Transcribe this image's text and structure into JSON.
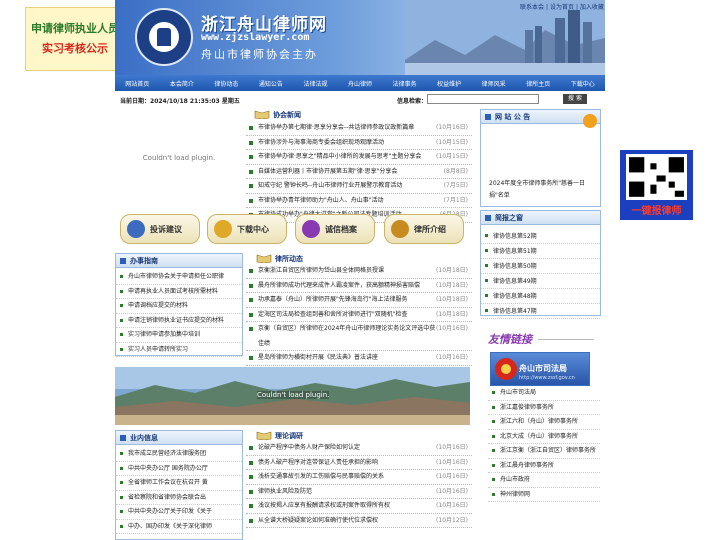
{
  "ads": {
    "left_line1": "申请律师执业人员",
    "left_line2": "实习考核公示",
    "right_text": "一键报律师"
  },
  "header": {
    "title": "浙江舟山律师网",
    "url": "www.zjzslawyer.com",
    "subtitle": "舟山市律师协会主办",
    "top_links": [
      "联系本会",
      "设为首页",
      "加入收藏"
    ]
  },
  "nav": [
    "网站首页",
    "本会简介",
    "律协动态",
    "通知公告",
    "法律法规",
    "舟山律师",
    "法律事务",
    "权益维护",
    "律师风采",
    "律所主页",
    "下载中心"
  ],
  "date": {
    "label": "当前日期：",
    "value": "2024/10/18 21:35:03 星期五"
  },
  "search": {
    "label": "信息检索：",
    "placeholder": "",
    "button": "搜 索"
  },
  "plugin_msg": "Couldn't load plugin.",
  "assoc_news": {
    "title": "协会新闻",
    "items": [
      {
        "t": "市律协举办第七期律·思享分享会--共话律师参政议政新篇章",
        "d": "(10月16日)"
      },
      {
        "t": "市律协涉外与海事海商专委会组织现场观摩活动",
        "d": "(10月15日)"
      },
      {
        "t": "市律协举办律·思享之\"精品中小律所的发展与思考\"主题分享会",
        "d": "(10月15日)"
      },
      {
        "t": "自媒体运营利器丨市律协开展第五期\"律·思享\"分享会",
        "d": "(8月8日)"
      },
      {
        "t": "知戒守纪 警钟长鸣--舟山市律师行业开展警示教育活动",
        "d": "(7月5日)"
      },
      {
        "t": "市律协举办青年律师助力\"舟山人、舟山事\"活动",
        "d": "(7月1日)"
      },
      {
        "t": "市律协成功举办\"舟律大讲堂\"之新公司法专题培训活动",
        "d": "(6月28日)"
      }
    ]
  },
  "announce": {
    "title": "网 站 公 告",
    "text": "2024年度全市律师事务所\"慈善一日捐\"名单"
  },
  "quick_buttons": [
    "投诉建议",
    "下载中心",
    "诚信档案",
    "律所介绍"
  ],
  "brief": {
    "title": "简报之窗",
    "items": [
      "律协信息第52期",
      "律协信息第51期",
      "律协信息第50期",
      "律协信息第49期",
      "律协信息第48期",
      "律协信息第47期"
    ]
  },
  "guide": {
    "title": "办事指南",
    "items": [
      "舟山市律师协会关于申请担任公职律",
      "申请再执业人员面试考核所需材料",
      "申请调档应提交的材料",
      "申请注销律师执业证书应提交的材料",
      "实习律师申请参加集中培训",
      "实习人员申请转所实习"
    ]
  },
  "lawyer_news": {
    "title": "律所动态",
    "items": [
      {
        "t": "京衡浙江自贸区所律师为岱山县全体网格员授课",
        "d": "(10月18日)"
      },
      {
        "t": "晨舟所律师成功代理来成件人霸凌案件，获高额精神损害赔偿",
        "d": "(10月18日)"
      },
      {
        "t": "功承嘉泰（舟山）所律师开展\"先锋海岛行\"海上法律服务",
        "d": "(10月18日)"
      },
      {
        "t": "定海区司法局检查组到善和舍所对律师进行\"双随机\"检查",
        "d": "(10月18日)"
      },
      {
        "t": "京衡（自贸区）所律师在2024年舟山市律师理论实务论文评选中获佳绩",
        "d": "(10月16日)"
      },
      {
        "t": "星岛所律师为横街村开展《民法典》普法讲座",
        "d": "(10月16日)"
      }
    ]
  },
  "photo_err": "Couldn't load plugin.",
  "friend_links": {
    "title": "友情链接",
    "banner_title": "舟山市司法局",
    "banner_sub": "http://www.zssf.gov.cn",
    "items": [
      "舟山市司法局",
      "浙江嘉俊律师事务所",
      "浙江六和（舟山）律师事务所",
      "北京大成（舟山）律师事务所",
      "浙江京衡（浙江自贸区）律师事务所",
      "浙江晨舟律师事务所",
      "舟山市政府",
      "神州律师网"
    ]
  },
  "industry": {
    "title": "业内信息",
    "items": [
      "我市成立民营经济法律服务团",
      "中共中央办公厅 国务院办公厅",
      "全省律师工作会议在杭召开 黄",
      "省检察院和省律师协会联合出",
      "中共中央办公厅关于印发《关于",
      "中办、国办印发《关于深化律师"
    ]
  },
  "theory": {
    "title": "理论调研",
    "items": [
      {
        "t": "论破产程序中债务人财产保险如何认定",
        "d": "(10月16日)"
      },
      {
        "t": "债务人破产程序对连带保证人责任承担的影响",
        "d": "(10月16日)"
      },
      {
        "t": "浅析交通事故引发的工伤赔偿与民事赔偿的关系",
        "d": "(10月16日)"
      },
      {
        "t": "律师执业风险及防范",
        "d": "(10月16日)"
      },
      {
        "t": "浅议按揭人应享有报酬请求权或刑案件取得所有权",
        "d": "(10月16日)"
      },
      {
        "t": "从全谱大桥疑疑案论如何准确行使代位求偿权",
        "d": "(10月12日)"
      }
    ]
  },
  "colors": {
    "nav_blue": "#1e56ad",
    "accent_green": "#2a7c2a",
    "ad_red": "#d8261b"
  }
}
